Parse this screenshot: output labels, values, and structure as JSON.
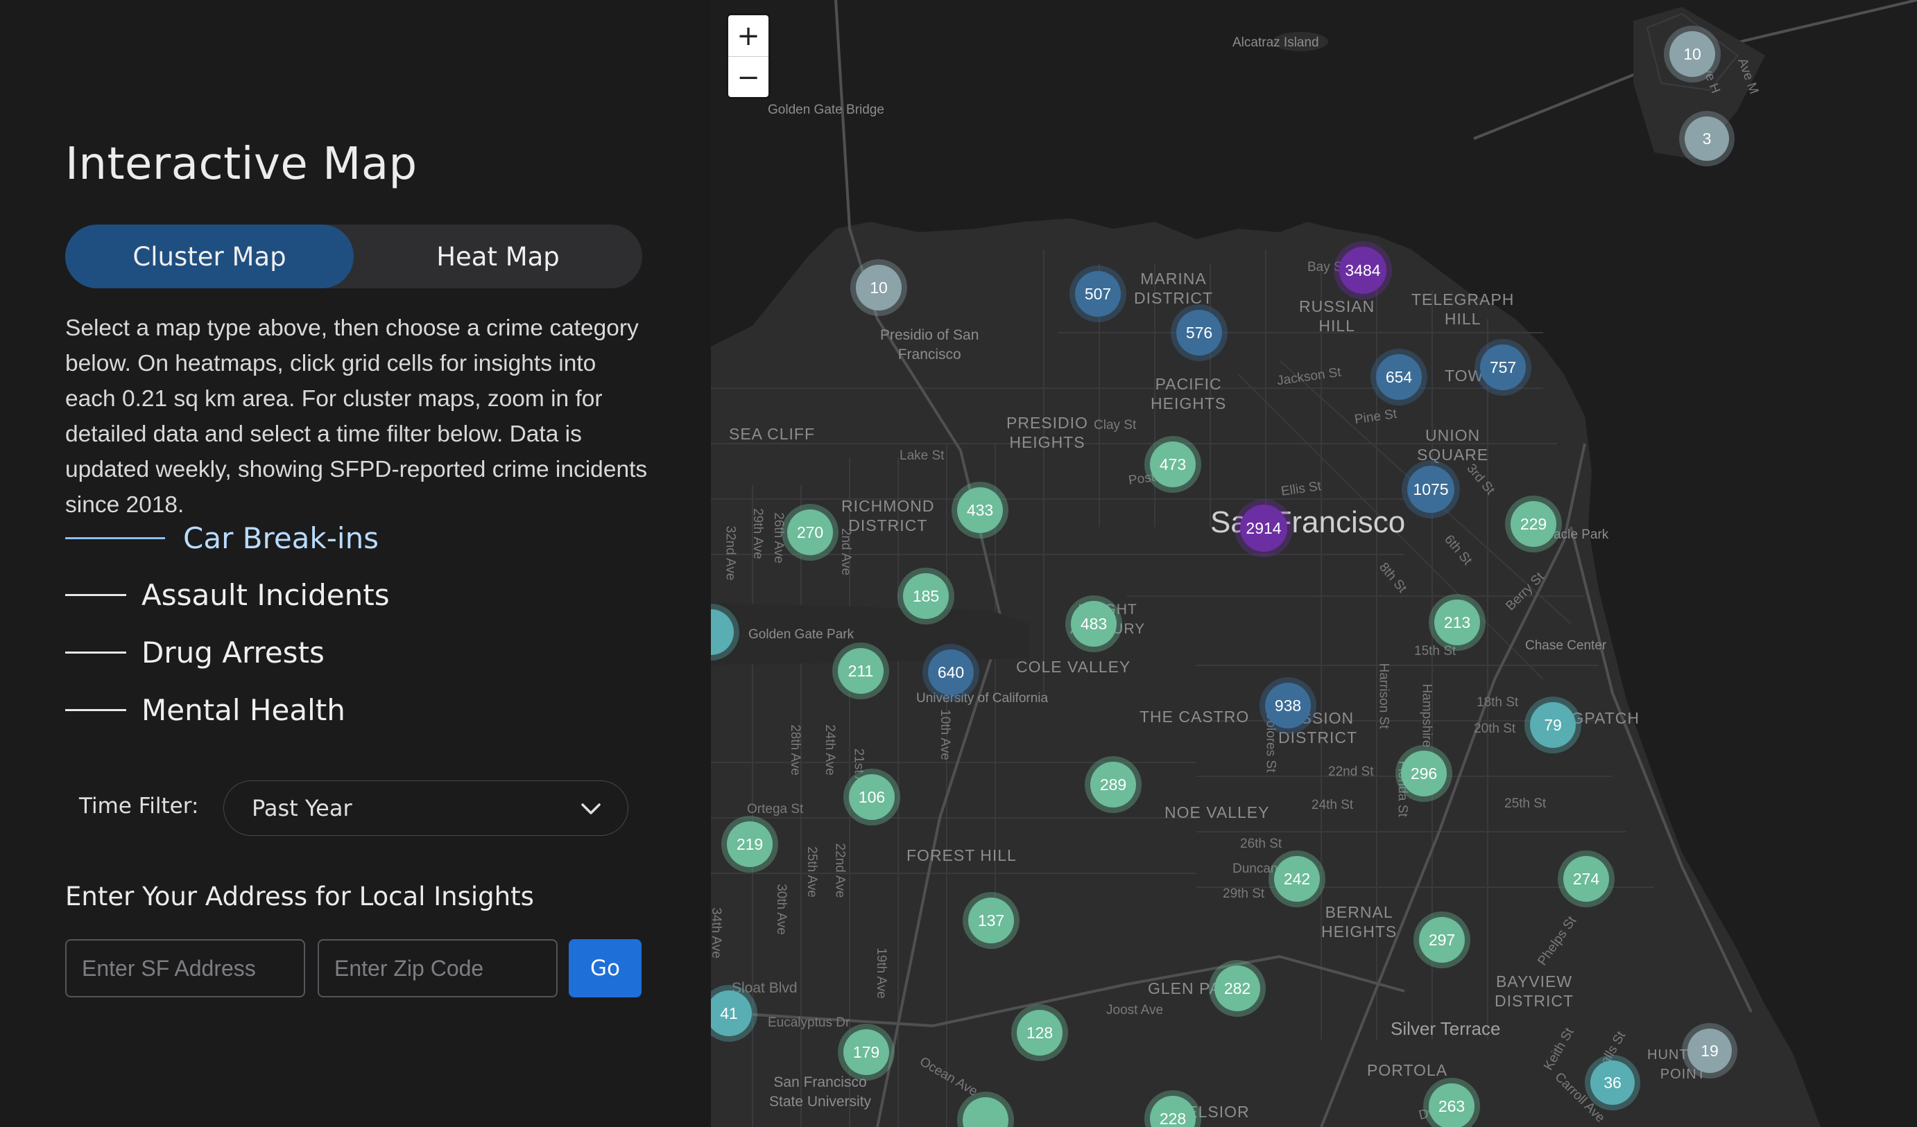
{
  "sidebar": {
    "title": "Interactive Map",
    "toggle": {
      "cluster_label": "Cluster Map",
      "heat_label": "Heat Map",
      "selected": "Cluster Map"
    },
    "description": "Select a map type above, then choose a crime category below. On heatmaps, click grid cells for insights into each 0.21 sq km area. For cluster maps, zoom in for detailed data and select a time filter below. Data is updated weekly, showing SFPD-reported crime incidents since 2018.",
    "categories": [
      {
        "label": "Car Break-ins",
        "active": true
      },
      {
        "label": "Assault Incidents",
        "active": false
      },
      {
        "label": "Drug Arrests",
        "active": false
      },
      {
        "label": "Mental Health",
        "active": false
      }
    ],
    "time_filter": {
      "label": "Time Filter:",
      "value": "Past Year"
    },
    "address": {
      "heading": "Enter Your Address for Local Insights",
      "address_placeholder": "Enter SF Address",
      "zip_placeholder": "Enter Zip Code",
      "go_label": "Go"
    }
  },
  "map": {
    "zoom_in": "+",
    "zoom_out": "−",
    "city_label": "San Francisco",
    "labels": {
      "alcatraz": "Alcatraz Island",
      "golden_gate_bridge": "Golden Gate Bridge",
      "marina": "MARINA\nDISTRICT",
      "russian_hill": "RUSSIAN\nHILL",
      "telegraph_hill": "TELEGRAPH\nHILL",
      "presidio": "Presidio of San\nFrancisco",
      "pacific_heights": "PACIFIC\nHEIGHTS",
      "presidio_heights": "PRESIDIO\nHEIGHTS",
      "sea_cliff": "SEA CLIFF",
      "union_square": "UNION\nSQUARE",
      "richmond": "RICHMOND\nDISTRICT",
      "golden_gate_park": "Golden Gate Park",
      "cole_valley": "COLE VALLEY",
      "ucsf": "University of California",
      "the_castro": "THE CASTRO",
      "mission": "MISSION\nDISTRICT",
      "noe_valley": "NOE VALLEY",
      "forest_hill": "FOREST HILL",
      "bernal": "BERNAL\nHEIGHTS",
      "glen_park": "GLEN PARK",
      "silver_terrace": "Silver Terrace",
      "bayview": "BAYVIEW\nDISTRICT",
      "portola": "PORTOLA",
      "excelsior": "EXCELSIOR",
      "sfsu": "San Francisco\nState University",
      "chase_center": "Chase Center",
      "oracle_park": "Oracle Park",
      "dogpatch": "DOGPATCH",
      "haight": "HAIGHT\nASHBURY",
      "hunters_point": "HUNTERS\nPOINT",
      "chinatown": "TOWN",
      "streets": [
        "Lake St",
        "Clay St",
        "Jackson St",
        "Pine St",
        "Post St",
        "Ellis St",
        "3rd St",
        "6th St",
        "8th St",
        "Berry St",
        "15th St",
        "18th St",
        "20th St",
        "22nd St",
        "24th St",
        "25th St",
        "26th St",
        "29th St",
        "Duncan St",
        "Ortega St",
        "Sloat Blvd",
        "Eucalyptus Dr",
        "Ocean Ave",
        "Joost Ave",
        "Harrison St",
        "Dolores St",
        "Florida St",
        "Hampshire St",
        "Phelps St",
        "Keith St",
        "Ingalls St",
        "Carroll Ave",
        "Dwight St",
        "Ave H",
        "Ave M",
        "Bay St",
        "32nd Ave",
        "29th Ave",
        "26th Ave",
        "28th Ave",
        "24th Ave",
        "21st Ave",
        "22nd Ave",
        "25th Ave",
        "30th Ave",
        "10th Ave",
        "19th Ave",
        "2nd Ave",
        "34th Ave"
      ]
    },
    "clusters": [
      {
        "value": "10",
        "color": "gray"
      },
      {
        "value": "3",
        "color": "gray"
      },
      {
        "value": "10",
        "color": "gray"
      },
      {
        "value": "507",
        "color": "blue"
      },
      {
        "value": "576",
        "color": "blue"
      },
      {
        "value": "3484",
        "color": "purple"
      },
      {
        "value": "654",
        "color": "blue"
      },
      {
        "value": "757",
        "color": "blue"
      },
      {
        "value": "473",
        "color": "green"
      },
      {
        "value": "1075",
        "color": "blue"
      },
      {
        "value": "2914",
        "color": "purple"
      },
      {
        "value": "229",
        "color": "green"
      },
      {
        "value": "270",
        "color": "green"
      },
      {
        "value": "433",
        "color": "green"
      },
      {
        "value": "185",
        "color": "green"
      },
      {
        "value": "483",
        "color": "green"
      },
      {
        "value": "213",
        "color": "green"
      },
      {
        "value": "211",
        "color": "green"
      },
      {
        "value": "640",
        "color": "blue"
      },
      {
        "value": "938",
        "color": "blue"
      },
      {
        "value": "79",
        "color": "teal"
      },
      {
        "value": "289",
        "color": "green"
      },
      {
        "value": "296",
        "color": "green"
      },
      {
        "value": "106",
        "color": "green"
      },
      {
        "value": "219",
        "color": "green"
      },
      {
        "value": "242",
        "color": "green"
      },
      {
        "value": "274",
        "color": "green"
      },
      {
        "value": "137",
        "color": "green"
      },
      {
        "value": "297",
        "color": "green"
      },
      {
        "value": "282",
        "color": "green"
      },
      {
        "value": "41",
        "color": "teal"
      },
      {
        "value": "128",
        "color": "green"
      },
      {
        "value": "179",
        "color": "green"
      },
      {
        "value": "19",
        "color": "gray"
      },
      {
        "value": "36",
        "color": "teal"
      },
      {
        "value": "263",
        "color": "green"
      },
      {
        "value": "228",
        "color": "green"
      }
    ]
  }
}
